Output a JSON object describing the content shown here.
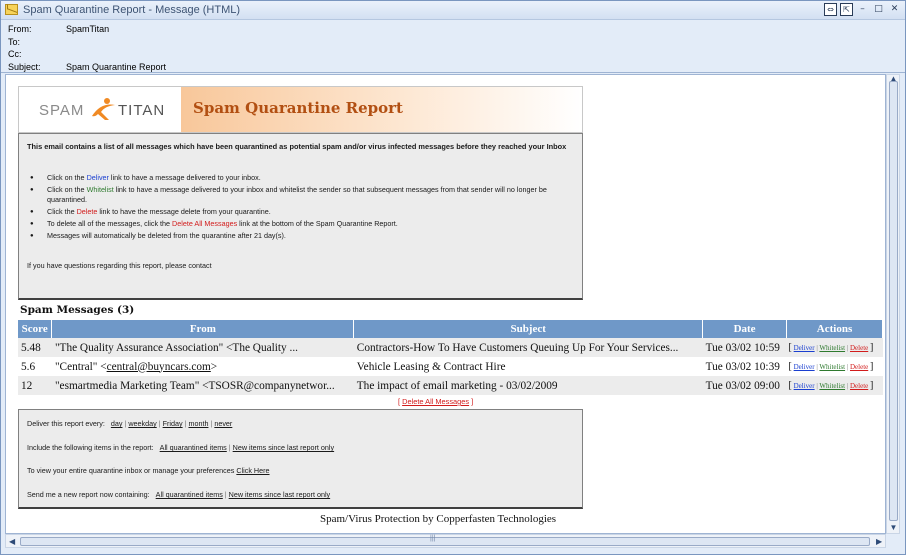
{
  "window": {
    "title": "Spam Quarantine Report - Message (HTML)",
    "controls": [
      "⇔",
      "⇱",
      "–",
      "□",
      "✕"
    ]
  },
  "header": {
    "from_label": "From:",
    "from_value": "SpamTitan",
    "to_label": "To:",
    "to_value": "",
    "cc_label": "Cc:",
    "cc_value": "",
    "subject_label": "Subject:",
    "subject_value": "Spam Quarantine Report"
  },
  "banner": {
    "logo_left": "SPAM",
    "logo_right": "TITAN",
    "title": "Spam Quarantine Report"
  },
  "info": {
    "intro": "This email contains a list of all messages which have been quarantined as potential spam and/or virus infected messages before they reached your Inbox",
    "b1_pre": "Click on the ",
    "b1_link": "Deliver",
    "b1_post": " link to have a message delivered to your inbox.",
    "b2_pre": "Click on the ",
    "b2_link": "Whitelist",
    "b2_post": " link to have a message delivered to your inbox and whitelist the sender so that subsequent messages from that sender will no longer be quarantined.",
    "b3_pre": "Click the ",
    "b3_link": "Delete",
    "b3_post": " link to have the message delete from your quarantine.",
    "b4_pre": "To delete all of the messages, click the ",
    "b4_link": "Delete All Messages",
    "b4_post": " link at the bottom of the Spam Quarantine Report.",
    "b5": "Messages will automatically be deleted from the quarantine after 21 day(s).",
    "contact": "If you have questions regarding this report, please contact"
  },
  "spam": {
    "title": "Spam Messages (3)",
    "columns": [
      "Score",
      "From",
      "Subject",
      "Date",
      "Actions"
    ],
    "rows": [
      {
        "score": "5.48",
        "from": "\"The Quality Assurance Association\" <The Quality ...",
        "subject": "Contractors-How To Have Customers Queuing Up For Your Services...",
        "date": "Tue 03/02 10:59"
      },
      {
        "score": "5.6",
        "from_pre": "\"Central\" <",
        "from_link": "central@buyncars.com",
        "from_post": ">",
        "subject": "Vehicle Leasing & Contract Hire",
        "date": "Tue 03/02 10:39"
      },
      {
        "score": "12",
        "from": "\"esmartmedia Marketing Team\" <TSOSR@companynetwor...",
        "subject": "The impact of email marketing - 03/02/2009",
        "date": "Tue 03/02 09:00"
      }
    ],
    "actions": {
      "open": "[",
      "deliver": "Deliver",
      "whitelist": "Whitelist",
      "delete": "Delete",
      "sep": "|",
      "close": "]"
    },
    "delete_all": "Delete All Messages"
  },
  "prefs": {
    "deliver_label": "Deliver this report every:",
    "freq": [
      "day",
      "weekday",
      "Friday",
      "month",
      "never"
    ],
    "include_label": "Include the following items in the report:",
    "include_all": "All quarantined items",
    "include_new": "New items since last report only",
    "view_label": "To view your entire quarantine inbox or manage your preferences",
    "click_here": "Click Here",
    "send_label": "Send me a new report now containing:",
    "send_all": "All quarantined items",
    "send_new": "New items since last report only"
  },
  "footer": "Spam/Virus Protection by Copperfasten Technologies",
  "colors": {
    "table_header": "#6f98c8",
    "banner_title": "#b24f12",
    "deliver": "#1a3fd0",
    "whitelist": "#2f7a2f",
    "delete": "#d21c1c"
  }
}
